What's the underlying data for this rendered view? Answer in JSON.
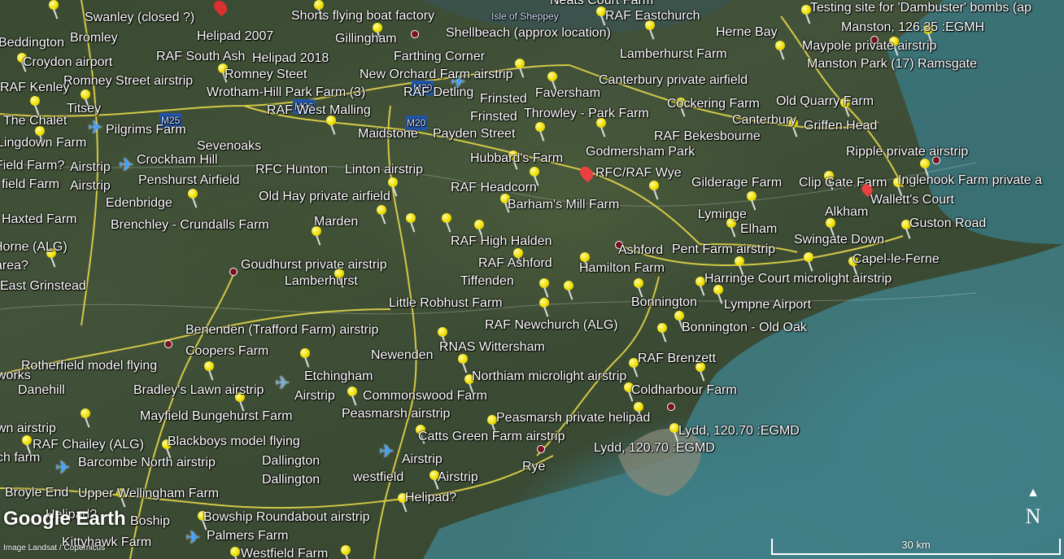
{
  "map": {
    "provider": "Google Earth",
    "credit": "Image Landsat / Copernicus",
    "scale_label": "30 km",
    "compass_label": "N",
    "road_shields": [
      "M25",
      "M20",
      "M20",
      "M26"
    ]
  },
  "labels": [
    "Swanley (closed ?)",
    "Shorts flying boat factory",
    "Isle of Sheppey",
    "Neats Court Farm",
    "RAF Eastchurch",
    "Testing site for 'Dambuster' bombs (ap",
    "Beddington",
    "Bromley",
    "Helipad 2007",
    "Gillingham",
    "Shellbeach (approx location)",
    "Herne Bay",
    "Manston, 126.35 :EGMH",
    "Croydon airport",
    "RAF South Ash",
    "Helipad 2018",
    "Farthing Corner",
    "Lamberhurst Farm",
    "Maypole private airstrip",
    "Manston Park (17) Ramsgate",
    "Romney Street airstrip",
    "Romney Steet",
    "New Orchard Farm airstrip",
    "RAF Kenley",
    "Wrotham-Hill Park Farm (3)",
    "RAF Detling",
    "Frinsted",
    "Faversham",
    "Canterbury private airfield",
    "Titsey",
    "RAF West Malling",
    "Old Quarry Farm",
    "Cockering Farm",
    "Frinsted",
    "Throwley - Park Farm",
    "Canterbury",
    "The Chalet",
    "Pilgrims Farm",
    "Maidstone",
    "Payden Street",
    "Griffen Head",
    "RAF Bekesbourne",
    "Lingdown Farm",
    "Sevenoaks",
    "Godmersham Park",
    "Ripple private airstrip",
    "Crockham Hill",
    "Hubbard's Farm",
    "Airstrip",
    "RFC Hunton",
    "Linton airstrip",
    "RFC/RAF Wye",
    "Field Farm?",
    "Penshurst Airfield",
    "Gilderage Farm",
    "Clip Gate Farm",
    "Inglenook Farm private a",
    "field Farm",
    "Airstrip",
    "RAF Headcorn",
    "Old Hay private airfield",
    "Wallett's Court",
    "Edenbridge",
    "Barham's Mill Farm",
    "Alkham",
    "Lyminge",
    "Guston Road",
    "Haxted Farm",
    "Brenchley - Crundalls Farm",
    "Marden",
    "Elham",
    "Swingate Down",
    "RAF High Halden",
    "Ashford",
    "Pent Farm airstrip",
    "Horne (ALG)",
    "RAF Ashford",
    "Capel-le-Ferne",
    "Goudhurst private airstrip",
    "Hamilton Farm",
    "area?",
    "Tiffenden",
    "Harringe Court microlight airstrip",
    "East Grinstead",
    "Lamberhurst",
    "Bonnington",
    "Little Robhust Farm",
    "Lympne Airport",
    "RAF Newchurch (ALG)",
    "Bonnington - Old Oak",
    "Benenden (Trafford Farm) airstrip",
    "Coopers Farm",
    "RNAS Wittersham",
    "Newenden",
    "RAF Brenzett",
    "Rotherfield model flying",
    "Etchingham",
    "Northiam microlight airstrip",
    "works",
    "Danehill",
    "Bradley's Lawn airstrip",
    "Airstrip",
    "Commonswood Farm",
    "Coldharbour Farm",
    "Mayfield Bungehurst Farm",
    "Peasmarsh airstrip",
    "Peasmarsh private helipad",
    "wn airstrip",
    "Lydd, 120.70 :EGMD",
    "RAF Chailey (ALG)",
    "Blackboys model flying",
    "Catts Green Farm airstrip",
    "Lydd, 120.70 :EGMD",
    "Dallington",
    "ch farm",
    "Barcombe North airstrip",
    "Dallington",
    "Airstrip",
    "Rye",
    "westfield",
    "Airstrip",
    "Broyle End",
    "Upper Wellingham Farm",
    "Helipad?",
    "Helipad?",
    "Boship",
    "Bowship Roundabout airstrip",
    "Palmers Farm",
    "Kittyhawk Farm",
    "Westfield Farm"
  ]
}
